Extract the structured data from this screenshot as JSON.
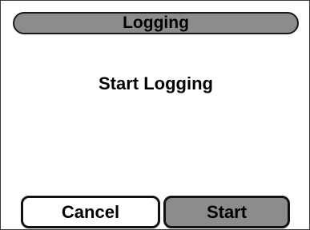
{
  "window": {
    "title": "Logging"
  },
  "main": {
    "message": "Start Logging"
  },
  "buttons": {
    "cancel_label": "Cancel",
    "start_label": "Start"
  },
  "colors": {
    "title_bar": "#8c8c8c",
    "start_button": "#8c8c8c",
    "cancel_button": "#ffffff",
    "border": "#1a1a1a",
    "background": "#ffffff"
  }
}
